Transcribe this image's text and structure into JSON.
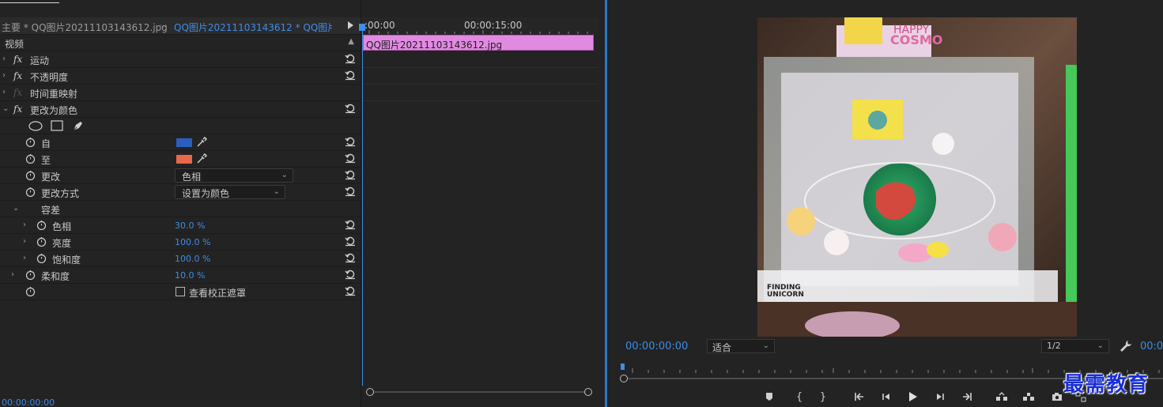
{
  "effect_controls": {
    "master_label": "主要 * QQ图片20211103143612.jpg",
    "sequence_label": "QQ图片20211103143612 * QQ图片2...",
    "video_header": "视频",
    "effects": {
      "motion": "运动",
      "opacity": "不透明度",
      "time_remap": "时间重映射",
      "change_to_color": "更改为颜色"
    },
    "params": {
      "from_label": "自",
      "to_label": "至",
      "change_label": "更改",
      "change_value": "色相",
      "change_by_label": "更改方式",
      "change_by_value": "设置为颜色",
      "tolerance_label": "容差",
      "hue_label": "色相",
      "hue_value": "30.0 %",
      "lightness_label": "亮度",
      "lightness_value": "100.0 %",
      "saturation_label": "饱和度",
      "saturation_value": "100.0 %",
      "softness_label": "柔和度",
      "softness_value": "10.0 %",
      "view_mask_label": "查看校正遮罩"
    },
    "colors": {
      "from": "#2a5fc0",
      "to": "#e8694a",
      "timecode": "#3e8de8"
    },
    "footer_timecode": "00:00:00:00"
  },
  "timeline": {
    "start_time": ":00:00",
    "mid_time": "00:00:15:00",
    "clip_name": "QQ图片20211103143612.jpg",
    "clip_color": "#e28ae2"
  },
  "program_monitor": {
    "timecode": "00:00:00:00",
    "fit_value": "适合",
    "resolution_value": "1/2",
    "right_timecode": "00:0",
    "watermark": "最需教育",
    "preview_texts": {
      "finding": "FINDING",
      "unicorn": "UNICORN",
      "cosmo": "COSMO",
      "happy": "HAPPY"
    }
  }
}
